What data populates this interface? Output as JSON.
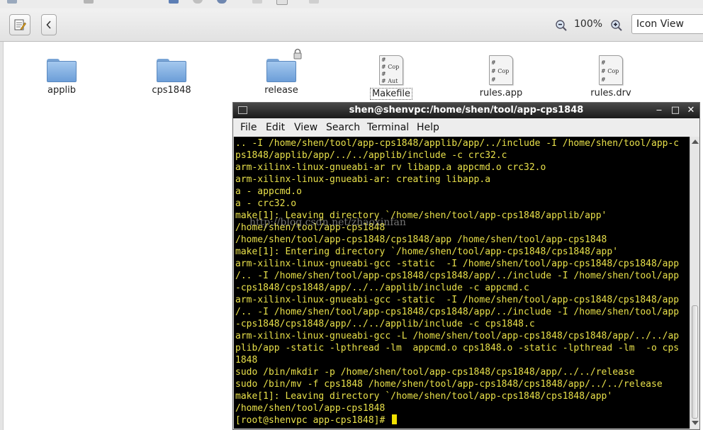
{
  "toolbar": {
    "zoom_level": "100%",
    "view_mode": "Icon View"
  },
  "files": [
    {
      "name": "applib",
      "type": "folder"
    },
    {
      "name": "cps1848",
      "type": "folder"
    },
    {
      "name": "release",
      "type": "folder",
      "locked": true
    },
    {
      "name": "Makefile",
      "type": "text-file",
      "preview": [
        "#",
        "# Cop",
        "#",
        "# Aut"
      ]
    },
    {
      "name": "rules.app",
      "type": "text-file",
      "preview": [
        "#",
        "# Cop",
        "#"
      ]
    },
    {
      "name": "rules.drv",
      "type": "text-file",
      "preview": [
        "#",
        "# Cop",
        "#"
      ]
    }
  ],
  "terminal": {
    "title": "shen@shenvpc:/home/shen/tool/app-cps1848",
    "menus": [
      "File",
      "Edit",
      "View",
      "Search",
      "Terminal",
      "Help"
    ],
    "text_color": "#e8e04a",
    "lines": [
      ".. -I /home/shen/tool/app-cps1848/applib/app/../include -I /home/shen/tool/app-c",
      "ps1848/applib/app/../../applib/include -c crc32.c",
      "arm-xilinx-linux-gnueabi-ar rv libapp.a appcmd.o crc32.o",
      "arm-xilinx-linux-gnueabi-ar: creating libapp.a",
      "a - appcmd.o",
      "a - crc32.o",
      "make[1]: Leaving directory `/home/shen/tool/app-cps1848/applib/app'",
      "/home/shen/tool/app-cps1848",
      "/home/shen/tool/app-cps1848/cps1848/app /home/shen/tool/app-cps1848",
      "make[1]: Entering directory `/home/shen/tool/app-cps1848/cps1848/app'",
      "arm-xilinx-linux-gnueabi-gcc -static  -I /home/shen/tool/app-cps1848/cps1848/app",
      "/.. -I /home/shen/tool/app-cps1848/cps1848/app/../include -I /home/shen/tool/app",
      "-cps1848/cps1848/app/../../applib/include -c appcmd.c",
      "arm-xilinx-linux-gnueabi-gcc -static  -I /home/shen/tool/app-cps1848/cps1848/app",
      "/.. -I /home/shen/tool/app-cps1848/cps1848/app/../include -I /home/shen/tool/app",
      "-cps1848/cps1848/app/../../applib/include -c cps1848.c",
      "arm-xilinx-linux-gnueabi-gcc -L /home/shen/tool/app-cps1848/cps1848/app/../../ap",
      "plib/app -static -lpthread -lm  appcmd.o cps1848.o -static -lpthread -lm  -o cps",
      "1848",
      "sudo /bin/mkdir -p /home/shen/tool/app-cps1848/cps1848/app/../../release",
      "sudo /bin/mv -f cps1848 /home/shen/tool/app-cps1848/cps1848/app/../../release",
      "make[1]: Leaving directory `/home/shen/tool/app-cps1848/cps1848/app'",
      "/home/shen/tool/app-cps1848",
      "[root@shenvpc app-cps1848]# "
    ]
  },
  "watermark": "http://blog.csdn.net/zhaoxinfan"
}
